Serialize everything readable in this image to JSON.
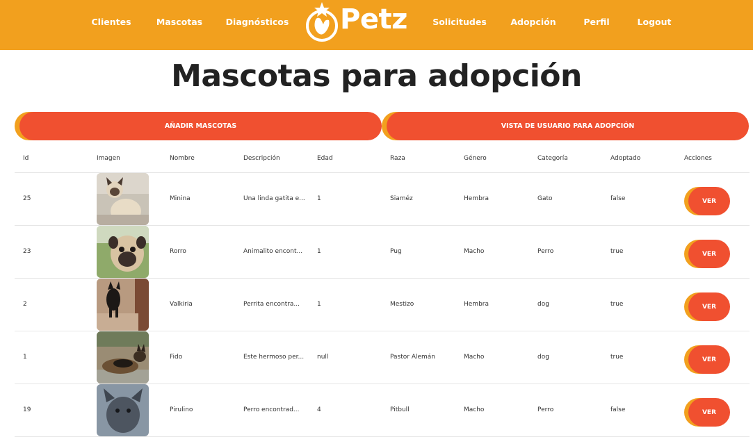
{
  "nav": {
    "items_left": [
      "Clientes",
      "Mascotas",
      "Diagnósticos"
    ],
    "items_right": [
      "Solicitudes",
      "Adopción",
      "Perfil",
      "Logout"
    ],
    "logo_text": "Petz"
  },
  "page": {
    "title": "Mascotas para adopción",
    "add_button": "AÑADIR MASCOTAS",
    "view_button": "VISTA DE USUARIO PARA ADOPCIÓN"
  },
  "table": {
    "headers": [
      "Id",
      "Imagen",
      "Nombre",
      "Descripción",
      "Edad",
      "Raza",
      "Género",
      "Categoría",
      "Adoptado",
      "Acciones"
    ],
    "action_label": "VER",
    "rows": [
      {
        "id": "25",
        "image": "siamese-cat-photo",
        "nombre": "Minina",
        "descripcion": "Una linda gatita e...",
        "edad": "1",
        "raza": "Siaméz",
        "genero": "Hembra",
        "categoria": "Gato",
        "adoptado": "false"
      },
      {
        "id": "23",
        "image": "pug-dog-photo",
        "nombre": "Rorro",
        "descripcion": "Animalito encont...",
        "edad": "1",
        "raza": "Pug",
        "genero": "Macho",
        "categoria": "Perro",
        "adoptado": "true"
      },
      {
        "id": "2",
        "image": "black-dog-photo",
        "nombre": "Valkiria",
        "descripcion": "Perrita encontra...",
        "edad": "1",
        "raza": "Mestizo",
        "genero": "Hembra",
        "categoria": "dog",
        "adoptado": "true"
      },
      {
        "id": "1",
        "image": "german-shepherd-photo",
        "nombre": "Fido",
        "descripcion": "Este hermoso per...",
        "edad": "null",
        "raza": "Pastor Alemán",
        "genero": "Macho",
        "categoria": "dog",
        "adoptado": "true"
      },
      {
        "id": "19",
        "image": "pitbull-photo",
        "nombre": "Pirulino",
        "descripcion": "Perro encontrad...",
        "edad": "4",
        "raza": "Pitbull",
        "genero": "Macho",
        "categoria": "Perro",
        "adoptado": "false"
      }
    ]
  },
  "colors": {
    "nav_bg": "#f2a01e",
    "button": "#f05030",
    "button_accent": "#f2a01e"
  }
}
